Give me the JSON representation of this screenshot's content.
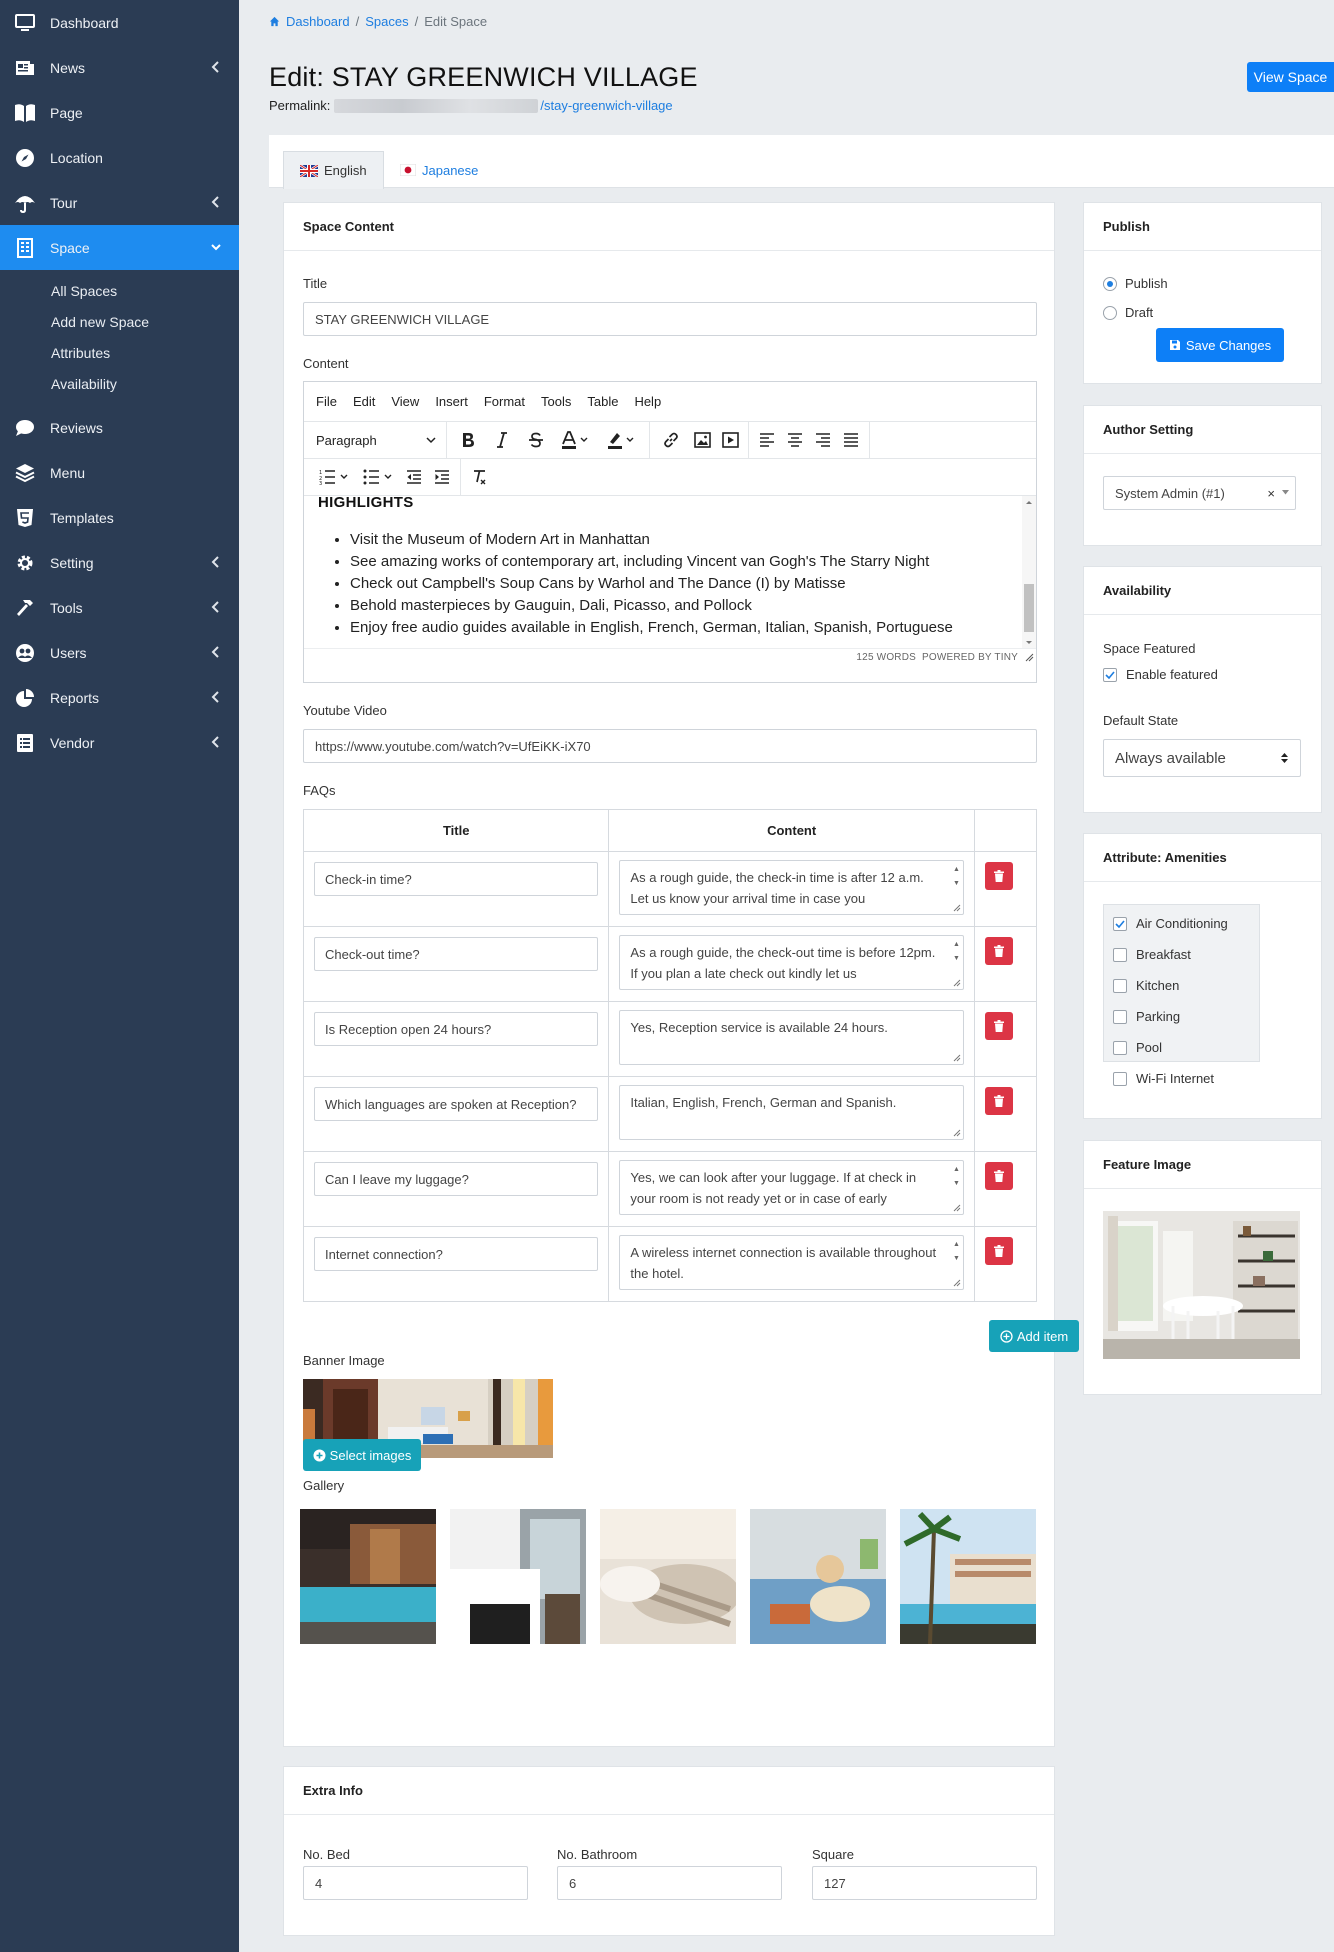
{
  "sidebar": {
    "items": [
      {
        "label": "Dashboard",
        "icon": "monitor-icon",
        "chevron": false
      },
      {
        "label": "News",
        "icon": "newspaper-icon",
        "chevron": true
      },
      {
        "label": "Page",
        "icon": "book-icon",
        "chevron": false
      },
      {
        "label": "Location",
        "icon": "compass-icon",
        "chevron": false
      },
      {
        "label": "Tour",
        "icon": "umbrella-icon",
        "chevron": true
      },
      {
        "label": "Space",
        "icon": "building-icon",
        "chevron": true,
        "active": true
      }
    ],
    "sub_items": [
      "All Spaces",
      "Add new Space",
      "Attributes",
      "Availability"
    ],
    "items_after": [
      {
        "label": "Reviews",
        "icon": "comment-icon"
      },
      {
        "label": "Menu",
        "icon": "layers-icon"
      },
      {
        "label": "Templates",
        "icon": "html5-icon"
      },
      {
        "label": "Setting",
        "icon": "cogs-icon"
      },
      {
        "label": "Tools",
        "icon": "hammer-icon"
      },
      {
        "label": "Users",
        "icon": "users-icon"
      },
      {
        "label": "Reports",
        "icon": "pie-chart-icon"
      },
      {
        "label": "Vendor",
        "icon": "list-icon"
      }
    ]
  },
  "breadcrumb": {
    "home": "Dashboard",
    "section": "Spaces",
    "current": "Edit Space",
    "sep": "/"
  },
  "header": {
    "title": "Edit: STAY GREENWICH VILLAGE",
    "permalink_label": "Permalink:",
    "permalink_slug": "/stay-greenwich-village",
    "view_button": "View Space"
  },
  "tabs": [
    {
      "label": "English"
    },
    {
      "label": "Japanese"
    }
  ],
  "content": {
    "heading": "Space Content",
    "title_label": "Title",
    "title_value": "STAY GREENWICH VILLAGE",
    "content_label": "Content",
    "editor": {
      "menu": [
        "File",
        "Edit",
        "View",
        "Insert",
        "Format",
        "Tools",
        "Table",
        "Help"
      ],
      "block_format": "Paragraph",
      "body_heading": "HIGHLIGHTS",
      "bullets": [
        "Visit the Museum of Modern Art in Manhattan",
        "See amazing works of contemporary art, including Vincent van Gogh's The Starry Night",
        "Check out Campbell's Soup Cans by Warhol and The Dance (I) by Matisse",
        "Behold masterpieces by Gauguin, Dali, Picasso, and Pollock",
        "Enjoy free audio guides available in English, French, German, Italian, Spanish, Portuguese"
      ],
      "word_count": "125 WORDS",
      "powered_by": "POWERED BY TINY"
    },
    "youtube_label": "Youtube Video",
    "youtube_value": "https://www.youtube.com/watch?v=UfEiKK-iX70",
    "faqs_label": "FAQs",
    "faq_headers": {
      "title": "Title",
      "content": "Content"
    },
    "faqs": [
      {
        "title": "Check-in time?",
        "content": "As a rough guide, the check-in time is after 12 a.m. Let us know your arrival time in case you",
        "scroll": true
      },
      {
        "title": "Check-out time?",
        "content": "As a rough guide, the check-out time is before 12pm. If you plan a late check out kindly let us",
        "scroll": true
      },
      {
        "title": "Is Reception open 24 hours?",
        "content": "Yes, Reception service is available 24 hours.",
        "scroll": false
      },
      {
        "title": "Which languages are spoken at Reception?",
        "content": "Italian, English, French, German and Spanish.",
        "scroll": false
      },
      {
        "title": "Can I leave my luggage?",
        "content": "Yes, we can look after your luggage. If at check in your room is not ready yet or in case of early",
        "scroll": true
      },
      {
        "title": "Internet connection?",
        "content": "A wireless internet connection is available throughout the hotel.",
        "scroll": true
      }
    ],
    "add_item": "Add item",
    "banner_label": "Banner Image",
    "gallery_label": "Gallery",
    "select_images": "Select images"
  },
  "extra": {
    "heading": "Extra Info",
    "bed_label": "No. Bed",
    "bed_value": "4",
    "bath_label": "No. Bathroom",
    "bath_value": "6",
    "square_label": "Square",
    "square_value": "127"
  },
  "publish": {
    "heading": "Publish",
    "options": [
      {
        "label": "Publish",
        "checked": true
      },
      {
        "label": "Draft",
        "checked": false
      }
    ],
    "save": "Save Changes"
  },
  "author": {
    "heading": "Author Setting",
    "value": "System Admin (#1)",
    "clear": "×"
  },
  "availability": {
    "heading": "Availability",
    "featured_label": "Space Featured",
    "featured_check": "Enable featured",
    "default_label": "Default State",
    "default_value": "Always available"
  },
  "amenities": {
    "heading": "Attribute: Amenities",
    "items": [
      {
        "label": "Air Conditioning",
        "checked": true
      },
      {
        "label": "Breakfast",
        "checked": false
      },
      {
        "label": "Kitchen",
        "checked": false
      },
      {
        "label": "Parking",
        "checked": false
      },
      {
        "label": "Pool",
        "checked": false
      },
      {
        "label": "Wi-Fi Internet",
        "checked": false
      }
    ]
  },
  "feature_image": {
    "heading": "Feature Image"
  },
  "colors": {
    "sidebar": "#2b3c54",
    "active": "#1e8cf0",
    "primary": "#0d7ff7",
    "info": "#17a2b8",
    "danger": "#dc3545"
  }
}
